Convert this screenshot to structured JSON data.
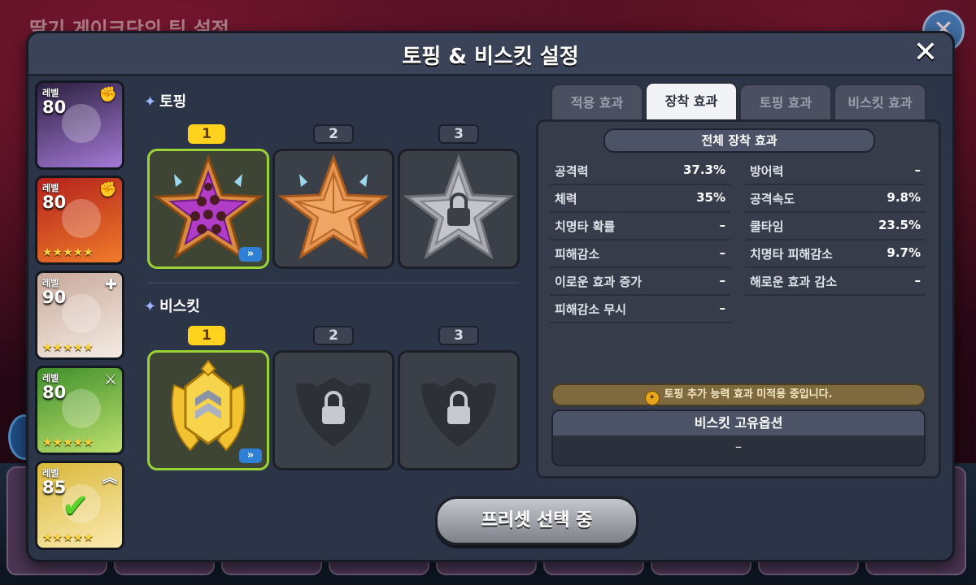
{
  "background": {
    "title": "딸기 게이크단의 팀 설정"
  },
  "modal": {
    "title": "토핑 & 비스킷 설정",
    "close_icon": "close-icon"
  },
  "cookies": [
    {
      "level_label": "레벨",
      "level": "80",
      "class_icon": "fist-icon",
      "stars": "",
      "colors": [
        "#2a1f3e",
        "#a47ad6"
      ]
    },
    {
      "level_label": "레벨",
      "level": "80",
      "class_icon": "fist-icon",
      "stars": "★★★★★",
      "colors": [
        "#b3211c",
        "#f07b2a"
      ]
    },
    {
      "level_label": "레벨",
      "level": "90",
      "class_icon": "plus-icon",
      "stars": "★★★★★",
      "colors": [
        "#c8a89a",
        "#f4ece4"
      ]
    },
    {
      "level_label": "레벨",
      "level": "80",
      "class_icon": "crossed-swords-icon",
      "stars": "★★★★★",
      "colors": [
        "#3f8f2a",
        "#bde06e"
      ]
    },
    {
      "level_label": "레벨",
      "level": "85",
      "class_icon": "chevron-up-icon",
      "stars": "★★★★★",
      "colors": [
        "#d9b83a",
        "#fbeab0"
      ],
      "checked": true
    }
  ],
  "topping": {
    "label": "토핑",
    "slots": [
      {
        "number": "1",
        "state": "equipped",
        "has_upgrade": true
      },
      {
        "number": "2",
        "state": "equipped",
        "has_upgrade": false
      },
      {
        "number": "3",
        "state": "locked",
        "has_upgrade": false
      }
    ]
  },
  "biscuit": {
    "label": "비스킷",
    "slots": [
      {
        "number": "1",
        "state": "equipped",
        "has_upgrade": true
      },
      {
        "number": "2",
        "state": "locked",
        "has_upgrade": false
      },
      {
        "number": "3",
        "state": "locked",
        "has_upgrade": false
      }
    ]
  },
  "tabs": [
    {
      "label": "적용 효과",
      "active": false
    },
    {
      "label": "장착 효과",
      "active": true
    },
    {
      "label": "토핑 효과",
      "active": false
    },
    {
      "label": "비스킷 효과",
      "active": false
    }
  ],
  "stats": {
    "header": "전체 장착 효과",
    "left": [
      {
        "name": "공격력",
        "value": "37.3%"
      },
      {
        "name": "체력",
        "value": "35%"
      },
      {
        "name": "치명타 확률",
        "value": "–"
      },
      {
        "name": "피해감소",
        "value": "–"
      },
      {
        "name": "이로운 효과 증가",
        "value": "–"
      },
      {
        "name": "피해감소 무시",
        "value": "–"
      }
    ],
    "right": [
      {
        "name": "방어력",
        "value": "–"
      },
      {
        "name": "공격속도",
        "value": "9.8%"
      },
      {
        "name": "쿨타임",
        "value": "23.5%"
      },
      {
        "name": "치명타 피해감소",
        "value": "9.7%"
      },
      {
        "name": "해로운 효과 감소",
        "value": "–"
      }
    ],
    "notice": "토핑 추가 능력 효과 미적용 중입니다.",
    "unique_header": "비스킷 고유옵션",
    "unique_value": "–"
  },
  "footer": {
    "preset_button": "프리셋 선택 중"
  },
  "colors": {
    "accent_selected": "#9cd334",
    "slot_active": "#ffd21e",
    "upgrade_badge": "#2f7fd6"
  }
}
